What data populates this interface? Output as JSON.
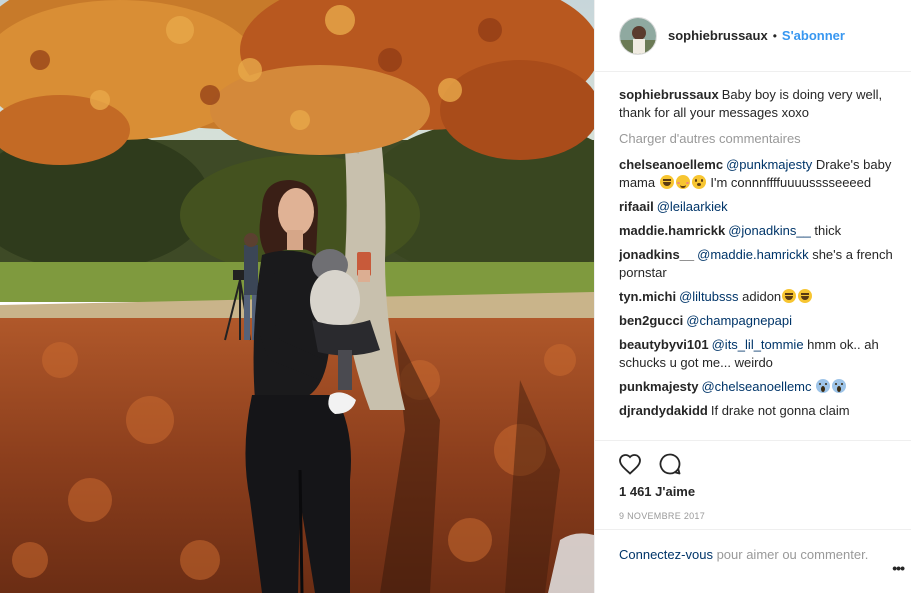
{
  "post": {
    "username": "sophiebrussaux",
    "separator": "•",
    "follow_label": "S'abonner",
    "caption": "Baby boy is doing very well, thank for all your messages xoxo",
    "load_more": "Charger d'autres commentaires",
    "likes": "1 461 J'aime",
    "date": "9 NOVEMBRE 2017",
    "add_comment": {
      "connect": "Connectez-vous",
      "rest": " pour aimer ou commenter."
    },
    "more_label": "•••"
  },
  "comments": [
    {
      "user": "chelseanoellemc",
      "mention": "@punkmajesty",
      "text": " Drake's baby mama ",
      "emojis": [
        "laugh",
        "blush",
        "wide"
      ],
      "text2": " I'm connnffffuuuusssseeeed"
    },
    {
      "user": "rifaail",
      "mention": "@leilaarkiek",
      "text": "",
      "emojis": [],
      "text2": ""
    },
    {
      "user": "maddie.hamrickk",
      "mention": "@jonadkins__",
      "text": " thick",
      "emojis": [],
      "text2": ""
    },
    {
      "user": "jonadkins__",
      "mention": "@maddie.hamrickk",
      "text": " she's a french pornstar",
      "emojis": [],
      "text2": ""
    },
    {
      "user": "tyn.michi",
      "mention": "@liltubsss",
      "text": " adidon",
      "emojis": [
        "laugh",
        "laugh"
      ],
      "text2": ""
    },
    {
      "user": "ben2gucci",
      "mention": "@champagnepapi",
      "text": "",
      "emojis": [],
      "text2": ""
    },
    {
      "user": "beautybyvi101",
      "mention": "@its_lil_tommie",
      "text": " hmm ok.. ah schucks u got me... weirdo",
      "emojis": [],
      "text2": ""
    },
    {
      "user": "punkmajesty",
      "mention": "@chelseanoellemc",
      "text": " ",
      "emojis": [
        "scream",
        "scream"
      ],
      "text2": ""
    },
    {
      "user": "djrandydakidd",
      "mention": "",
      "text": "If drake not gonna claim",
      "emojis": [],
      "text2": ""
    }
  ],
  "icons": {
    "like": "heart-icon",
    "comment": "comment-bubble-icon",
    "more": "ellipsis-icon"
  },
  "colors": {
    "link_blue": "#3897f0",
    "mention": "#003569",
    "muted": "#999999",
    "text": "#262626"
  }
}
